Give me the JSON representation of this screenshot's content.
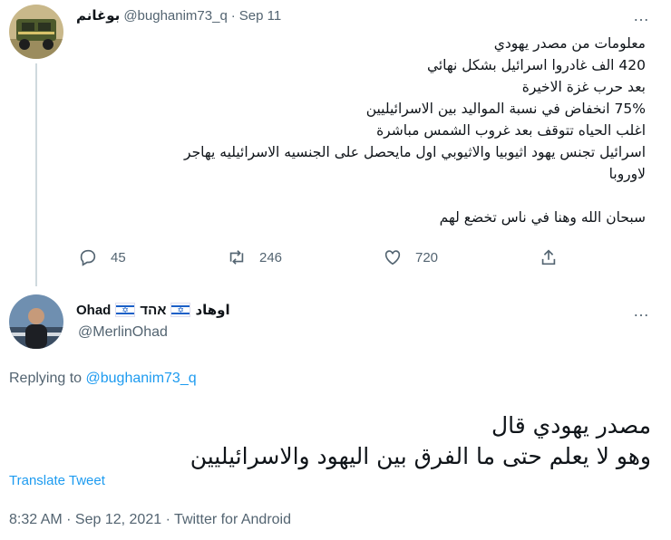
{
  "tweet1": {
    "display_name": "بوغانم",
    "handle": "@bughanim73_q",
    "separator": "·",
    "date": "Sep 11",
    "more_icon": "…",
    "lines": [
      "معلومات من مصدر يهودي",
      "420 الف غادروا اسرائيل بشكل نهائي",
      "بعد حرب غزة الاخيرة",
      "75% انخفاض في نسبة المواليد بين الاسرائيليين",
      "اغلب الحياه تتوقف بعد غروب الشمس مباشرة",
      "اسرائيل تجنس يهود اثيوبيا والاثيوبي اول مايحصل على الجنسيه الاسرائيليه يهاجر",
      "لاوروبا",
      "سبحان الله وهنا في ناس تخضع لهم"
    ],
    "actions": {
      "replies": "45",
      "retweets": "246",
      "likes": "720"
    }
  },
  "tweet2": {
    "display_name_en": "Ohad",
    "display_name_he": "אהד",
    "display_name_ar": "اوهاد",
    "handle": "@MerlinOhad",
    "replying_prefix": "Replying to",
    "replying_handle": "@bughanim73_q",
    "lines": [
      "مصدر يهودي قال",
      "وهو لا يعلم حتى ما الفرق بين اليهود والاسرائيليين"
    ],
    "translate": "Translate Tweet",
    "timestamp": "8:32 AM · Sep 12, 2021 · Twitter for Android"
  },
  "colors": {
    "link": "#1d9bf0",
    "muted": "#536471",
    "text": "#0f1419",
    "line": "#cfd9de"
  },
  "icons": [
    "more-icon",
    "reply-icon",
    "retweet-icon",
    "like-icon",
    "share-icon",
    "israel-flag-icon"
  ]
}
